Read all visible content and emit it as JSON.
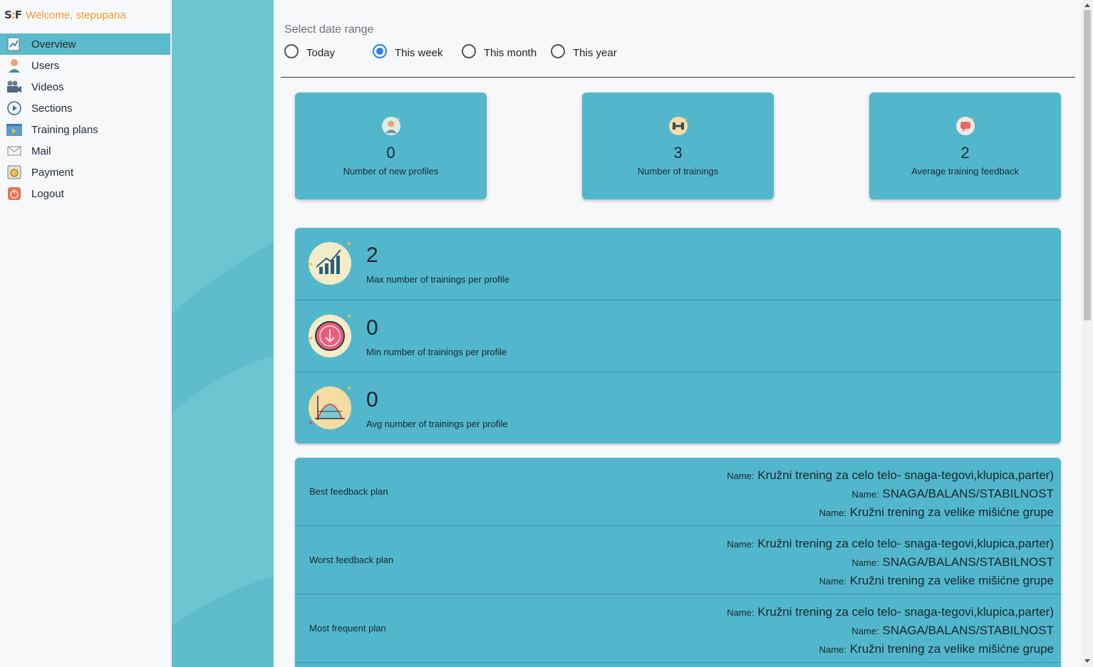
{
  "brand": {
    "logo_text": "S F",
    "welcome": "Welcome, stepupana"
  },
  "sidebar": {
    "items": [
      {
        "label": "Overview",
        "icon": "chart-icon",
        "active": true
      },
      {
        "label": "Users",
        "icon": "user-icon"
      },
      {
        "label": "Videos",
        "icon": "video-camera-icon"
      },
      {
        "label": "Sections",
        "icon": "play-circle-icon"
      },
      {
        "label": "Training plans",
        "icon": "folder-play-icon"
      },
      {
        "label": "Mail",
        "icon": "envelope-icon"
      },
      {
        "label": "Payment",
        "icon": "payment-icon"
      },
      {
        "label": "Logout",
        "icon": "power-icon"
      }
    ]
  },
  "date_range": {
    "label": "Select date range",
    "options": [
      "Today",
      "This week",
      "This month",
      "This year"
    ],
    "selected": "This week"
  },
  "cards": [
    {
      "value": "0",
      "label": "Number of new profiles",
      "icon": "user-badge-icon"
    },
    {
      "value": "3",
      "label": "Number of trainings",
      "icon": "dumbbell-icon"
    },
    {
      "value": "2",
      "label": "Average training feedback",
      "icon": "speech-bubble-icon"
    }
  ],
  "stats": [
    {
      "value": "2",
      "label": "Max number of trainings per profile",
      "icon": "bar-growth-icon"
    },
    {
      "value": "0",
      "label": "Min number of trainings per profile",
      "icon": "down-arrow-icon"
    },
    {
      "value": "0",
      "label": "Avg number of trainings per profile",
      "icon": "bell-curve-icon"
    }
  ],
  "plans": {
    "name_prefix": "Name:",
    "rows": [
      {
        "label": "Best feedback plan",
        "names": [
          "Kružni trening za celo telo- snaga-tegovi,klupica,parter)",
          "SNAGA/BALANS/STABILNOST",
          "Kružni trening za velike mišićne grupe"
        ]
      },
      {
        "label": "Worst feedback plan",
        "names": [
          "Kružni trening za celo telo- snaga-tegovi,klupica,parter)",
          "SNAGA/BALANS/STABILNOST",
          "Kružni trening za velike mišićne grupe"
        ]
      },
      {
        "label": "Most frequent plan",
        "names": [
          "Kružni trening za celo telo- snaga-tegovi,klupica,parter)",
          "SNAGA/BALANS/STABILNOST",
          "Kružni trening za velike mišićne grupe"
        ]
      }
    ]
  },
  "colors": {
    "accent": "#53b7cb",
    "active_nav": "#5bbacb",
    "brand": "#f39a2d",
    "radio_checked": "#2f7fe0"
  }
}
